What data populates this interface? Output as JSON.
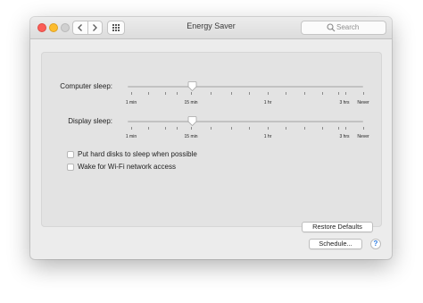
{
  "window": {
    "title": "Energy Saver"
  },
  "toolbar": {
    "back_icon": "chevron-left-icon",
    "forward_icon": "chevron-right-icon",
    "grid_icon": "show-all-grid-icon"
  },
  "search": {
    "placeholder": "Search",
    "icon": "search-icon"
  },
  "sliders": {
    "computer_sleep": {
      "label": "Computer sleep:",
      "value": "15 min",
      "ticks": {
        "min1": "1 min",
        "min15": "15 min",
        "hr1": "1 hr",
        "hrs3": "3 hrs",
        "never": "Never"
      }
    },
    "display_sleep": {
      "label": "Display sleep:",
      "value": "15 min",
      "ticks": {
        "min1": "1 min",
        "min15": "15 min",
        "hr1": "1 hr",
        "hrs3": "3 hrs",
        "never": "Never"
      }
    }
  },
  "options": {
    "hard_disks": {
      "label": "Put hard disks to sleep when possible",
      "checked": false
    },
    "wake_wifi": {
      "label": "Wake for Wi-Fi network access",
      "checked": false
    }
  },
  "buttons": {
    "restore_defaults": "Restore Defaults",
    "schedule": "Schedule...",
    "help": "?"
  },
  "colors": {
    "close": "#fc5d57",
    "minimize": "#fdbc2e",
    "accent": "#2a7ae2"
  }
}
